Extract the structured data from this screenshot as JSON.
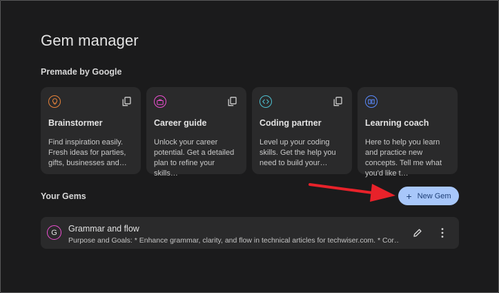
{
  "page": {
    "title": "Gem manager"
  },
  "premade": {
    "label": "Premade by Google",
    "cards": [
      {
        "name": "Brainstormer",
        "desc": "Find inspiration easily. Fresh ideas for parties, gifts, businesses and…",
        "icon": "lightbulb-icon",
        "color": "#e8833a"
      },
      {
        "name": "Career guide",
        "desc": "Unlock your career potential. Get a detailed plan to refine your skills…",
        "icon": "briefcase-icon",
        "color": "#ee4fd2"
      },
      {
        "name": "Coding partner",
        "desc": "Level up your coding skills. Get the help you need to build your…",
        "icon": "code-icon",
        "color": "#4ec3d4"
      },
      {
        "name": "Learning coach",
        "desc": "Here to help you learn and practice new concepts. Tell me what you'd like t…",
        "icon": "book-icon",
        "color": "#5b8bff"
      }
    ]
  },
  "your_gems": {
    "label": "Your Gems",
    "new_button": "New Gem",
    "items": [
      {
        "avatar": "G",
        "name": "Grammar and flow",
        "desc": "Purpose and Goals: * Enhance grammar, clarity, and flow in technical articles for techwiser.com. * Cor…"
      }
    ]
  },
  "colors": {
    "accent": "#a8c7fa",
    "annotation_arrow": "#e8222a"
  }
}
